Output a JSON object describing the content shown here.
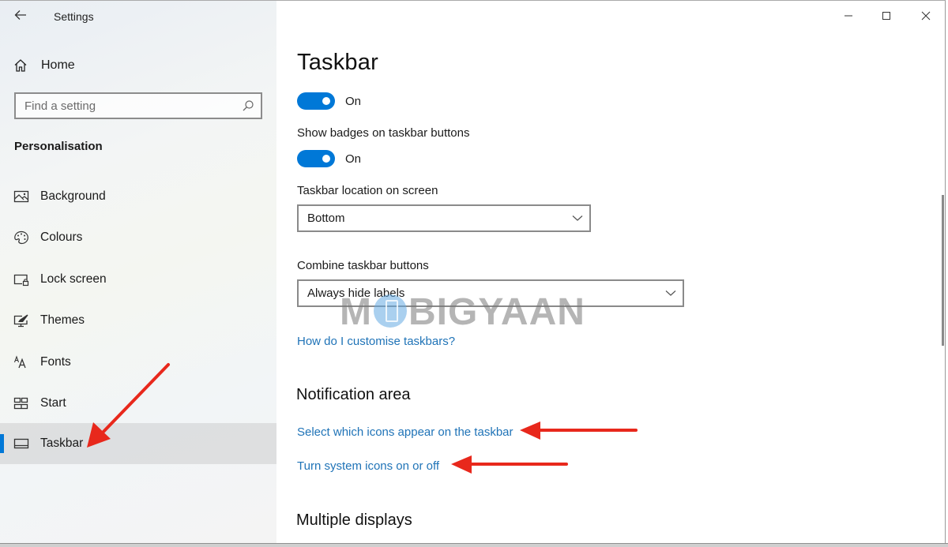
{
  "window": {
    "title": "Settings",
    "caption_buttons": [
      {
        "name": "minimize",
        "icon": "minimize-icon"
      },
      {
        "name": "maximize",
        "icon": "maximize-icon"
      },
      {
        "name": "close",
        "icon": "close-icon"
      }
    ]
  },
  "sidebar": {
    "back_icon": "back-arrow-icon",
    "home": {
      "label": "Home",
      "icon": "home-icon"
    },
    "search": {
      "placeholder": "Find a setting",
      "value": "",
      "icon": "search-icon"
    },
    "section_label": "Personalisation",
    "items": [
      {
        "label": "Background",
        "icon": "background-image-icon",
        "selected": false
      },
      {
        "label": "Colours",
        "icon": "palette-icon",
        "selected": false
      },
      {
        "label": "Lock screen",
        "icon": "lock-screen-icon",
        "selected": false
      },
      {
        "label": "Themes",
        "icon": "themes-icon",
        "selected": false
      },
      {
        "label": "Fonts",
        "icon": "fonts-icon",
        "selected": false
      },
      {
        "label": "Start",
        "icon": "start-icon",
        "selected": false
      },
      {
        "label": "Taskbar",
        "icon": "taskbar-icon",
        "selected": true
      }
    ]
  },
  "main": {
    "title": "Taskbar",
    "toggle1": {
      "state": "On",
      "on": true
    },
    "badges": {
      "label": "Show badges on taskbar buttons",
      "state": "On",
      "on": true
    },
    "location": {
      "label": "Taskbar location on screen",
      "value": "Bottom"
    },
    "combine": {
      "label": "Combine taskbar buttons",
      "value": "Always hide labels"
    },
    "help_link": "How do I customise taskbars?",
    "notification_area": {
      "title": "Notification area",
      "links": [
        "Select which icons appear on the taskbar",
        "Turn system icons on or off"
      ]
    },
    "multiple_displays": {
      "title": "Multiple displays"
    }
  },
  "watermark": {
    "text_before": "M",
    "text_after": "BIGYAAN"
  },
  "colors": {
    "accent": "#0078d7",
    "link": "#1f73b7",
    "annotation_arrow": "#e8281c"
  }
}
